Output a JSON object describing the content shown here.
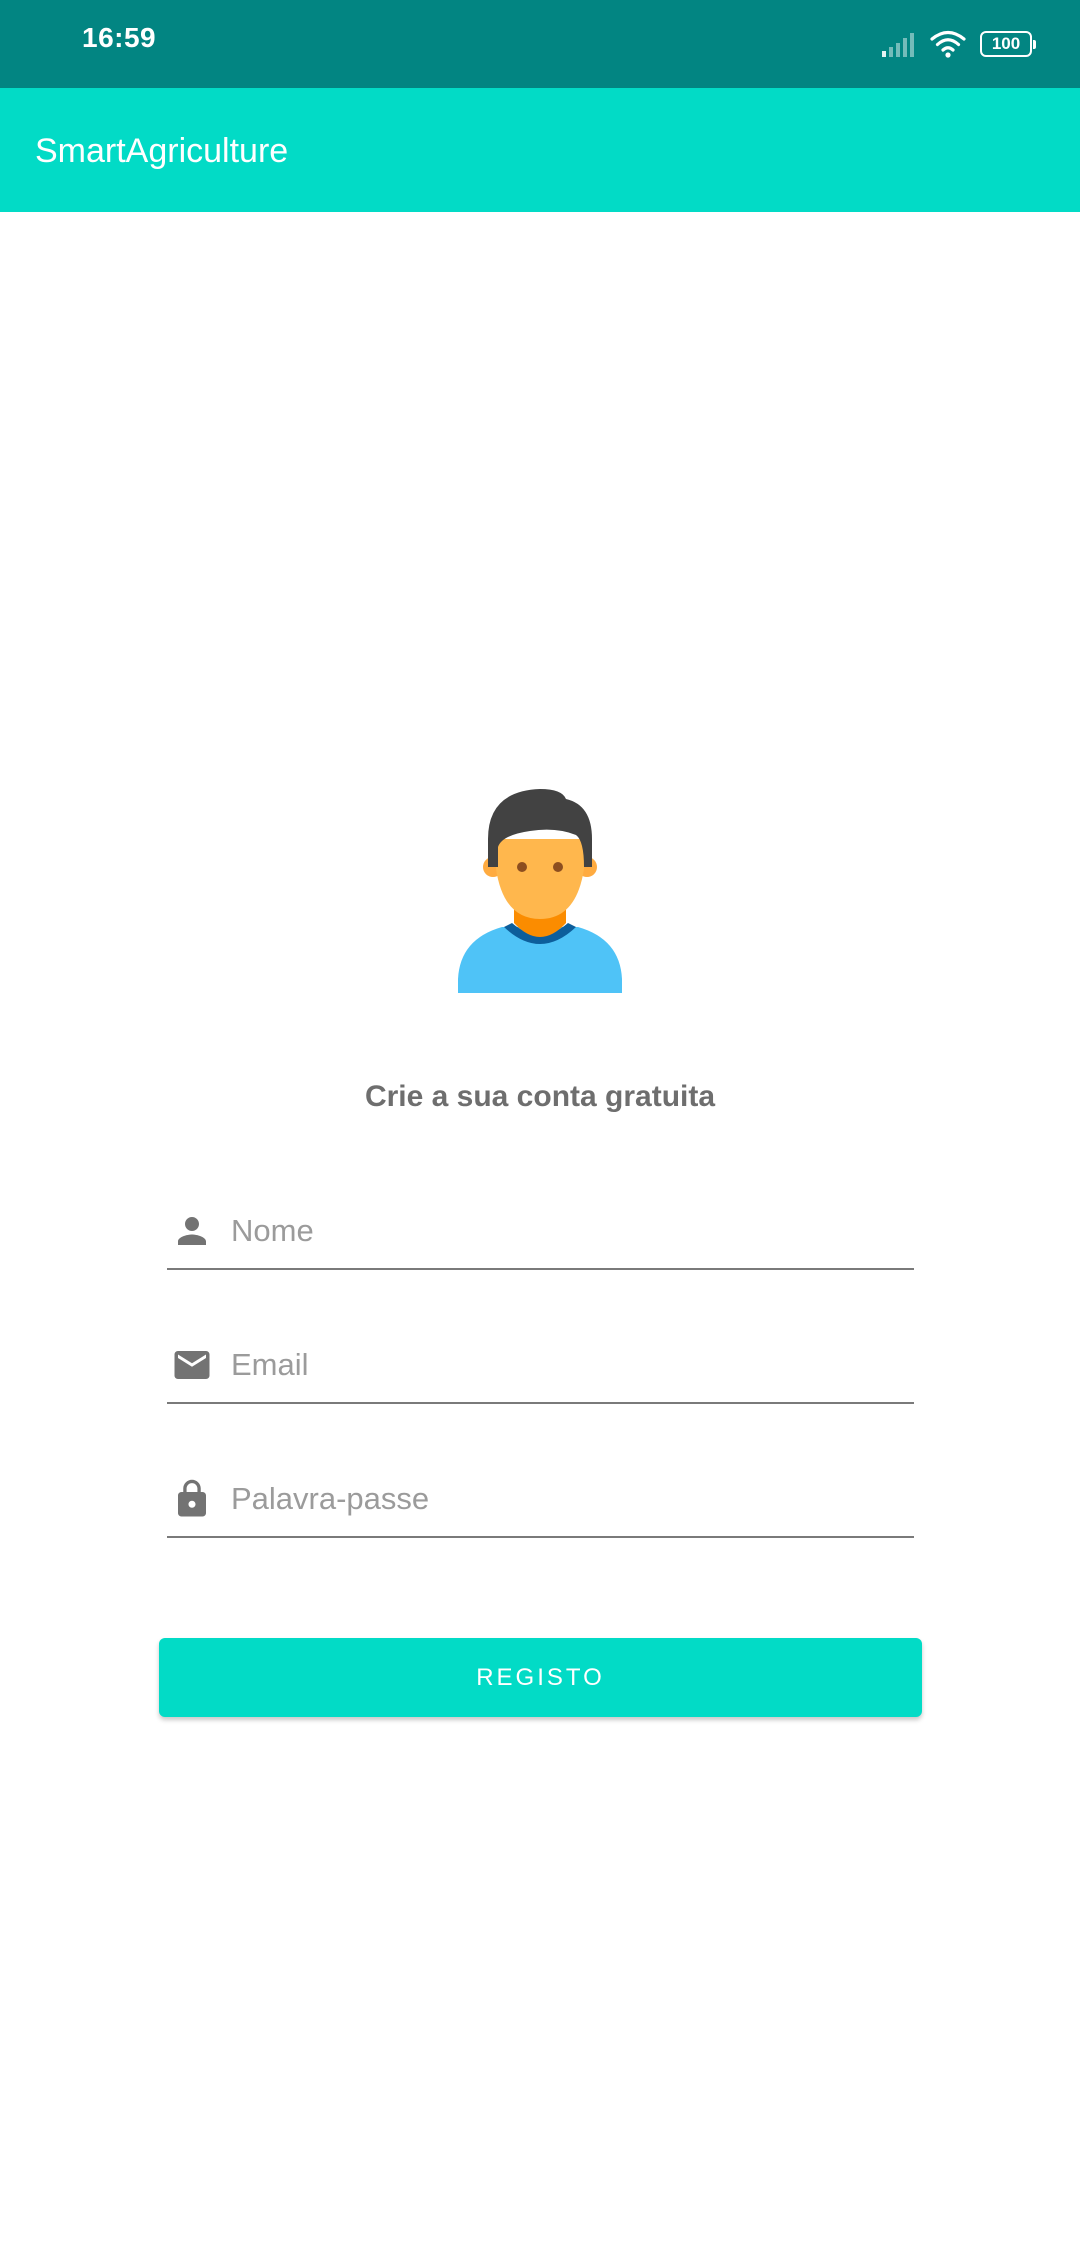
{
  "status_bar": {
    "time": "16:59",
    "battery_level": "100",
    "icons": [
      "signal-icon",
      "wifi-icon",
      "battery-icon"
    ]
  },
  "app_bar": {
    "title": "SmartAgriculture"
  },
  "main": {
    "avatar_icon": "user-avatar-icon",
    "headline": "Crie a sua conta gratuita",
    "fields": {
      "name": {
        "placeholder": "Nome",
        "value": "",
        "icon": "person-icon"
      },
      "email": {
        "placeholder": "Email",
        "value": "",
        "icon": "mail-icon"
      },
      "password": {
        "placeholder": "Palavra-passe",
        "value": "",
        "icon": "lock-icon"
      }
    },
    "register_label": "REGISTO"
  },
  "colors": {
    "status_bar": "#028582",
    "accent": "#02dbc6",
    "icon_gray": "#737373",
    "text_gray": "#6e6e6e"
  }
}
